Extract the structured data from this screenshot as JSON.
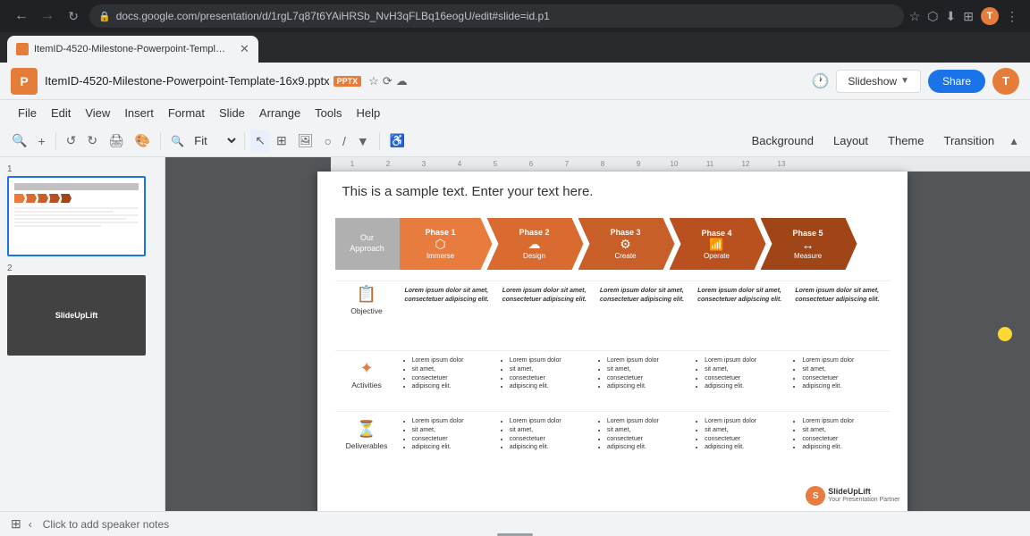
{
  "browser": {
    "url": "docs.google.com/presentation/d/1rgL7q87t6YAiHRSb_NvH3qFLBq16eogU/edit#slide=id.p1",
    "tab_title": "ItemID-4520-Milestone-Powerpoint-Template-16x9.pptx",
    "pptx_badge": "PPTX"
  },
  "app": {
    "title": "ItemID-4520-Milestone-Powerpoint-Template-16x9.pptx",
    "slideshow_label": "Slideshow",
    "share_label": "Share",
    "user_initial": "T"
  },
  "menu": {
    "items": [
      "File",
      "Edit",
      "View",
      "Insert",
      "Format",
      "Slide",
      "Arrange",
      "Tools",
      "Help"
    ]
  },
  "toolbar": {
    "fit_label": "Fit",
    "background_label": "Background",
    "layout_label": "Layout",
    "theme_label": "Theme",
    "transition_label": "Transition"
  },
  "slide": {
    "title": "This is a sample text. Enter your text here.",
    "our_approach": "Our\nApproach",
    "phases": [
      {
        "label": "Phase 1",
        "icon": "⬡",
        "sublabel": "Immerse"
      },
      {
        "label": "Phase 2",
        "icon": "☁",
        "sublabel": "Design"
      },
      {
        "label": "Phase 3",
        "icon": "⚙",
        "sublabel": "Create"
      },
      {
        "label": "Phase 4",
        "icon": "📶",
        "sublabel": "Operate"
      },
      {
        "label": "Phase 5",
        "icon": "↔",
        "sublabel": "Measure"
      }
    ],
    "rows": [
      {
        "icon": "📋",
        "label": "Objective",
        "cells": [
          "Lorem ipsum dolor sit amet, consectetuer adipiscing elit.",
          "Lorem ipsum dolor sit amet, consectetuer adipiscing elit.",
          "Lorem ipsum dolor sit amet, consectetuer adipiscing elit.",
          "Lorem ipsum dolor sit amet, consectetuer adipiscing elit.",
          "Lorem ipsum dolor sit amet, consectetuer adipiscing elit."
        ],
        "bold": true
      },
      {
        "icon": "✦",
        "label": "Activities",
        "cells": [
          "Lorem ipsum dolor\nsit amet,\nconsectetuer\nadipiscing elit.",
          "Lorem ipsum dolor\nsit amet,\nconsectetuer\nadipiscing elit.",
          "Lorem ipsum dolor\nsit amet,\nconsectetuer\nadipiscing elit.",
          "Lorem ipsum dolor\nsit amet,\nconsectetuer\nadipiscing elit.",
          "Lorem ipsum dolor\nsit amet,\nconsectetuer\nadipiscing elit."
        ],
        "bold": false,
        "list": true
      },
      {
        "icon": "⏳",
        "label": "Deliverables",
        "cells": [
          "Lorem ipsum dolor\nsit amet,\nconsectetuer\nadipiscing elit.",
          "Lorem ipsum dolor\nsit amet,\nconsectetuer\nadipiscing elit.",
          "Lorem ipsum dolor\nsit amet,\nconsectetuer\nadipiscing elit.",
          "Lorem ipsum dolor\nsit amet,\nconsectetuer\nadipiscing elit.",
          "Lorem ipsum dolor\nsit amet,\nconsectetuer\nadipiscing elit."
        ],
        "bold": false,
        "list": true
      }
    ],
    "logo_name": "SlideUpLift",
    "logo_sub": "Your Presentation Partner"
  },
  "bottom_bar": {
    "notes_placeholder": "Click to add speaker notes"
  },
  "slides_panel": {
    "slide1_num": "1",
    "slide2_num": "2",
    "slide2_label": "SlideUpLift"
  }
}
